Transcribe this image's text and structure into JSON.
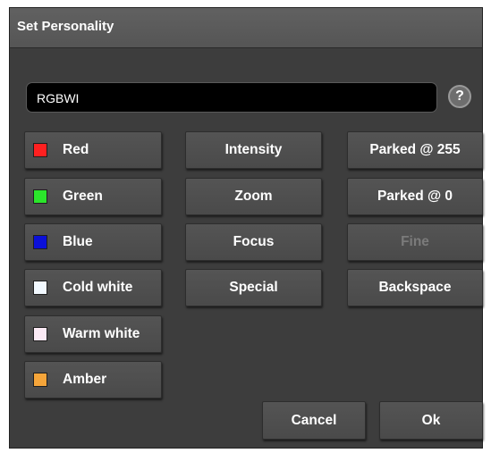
{
  "dialog": {
    "title": "Set Personality"
  },
  "personality_input": {
    "value": "RGBWI"
  },
  "help_icon": "?",
  "channels": [
    {
      "label": "Red",
      "color": "#ff2020"
    },
    {
      "label": "Green",
      "color": "#2be62b"
    },
    {
      "label": "Blue",
      "color": "#0b10d8"
    },
    {
      "label": "Cold white",
      "color": "#f2f9ff"
    },
    {
      "label": "Warm white",
      "color": "#fbeaf5"
    },
    {
      "label": "Amber",
      "color": "#f5a53a"
    }
  ],
  "attributes": [
    {
      "label": "Intensity"
    },
    {
      "label": "Zoom"
    },
    {
      "label": "Focus"
    },
    {
      "label": "Special"
    }
  ],
  "parking": [
    {
      "label": "Parked @ 255"
    },
    {
      "label": "Parked @ 0"
    },
    {
      "label": "Fine",
      "disabled": true
    },
    {
      "label": "Backspace"
    }
  ],
  "actions": {
    "cancel": "Cancel",
    "ok": "Ok"
  }
}
